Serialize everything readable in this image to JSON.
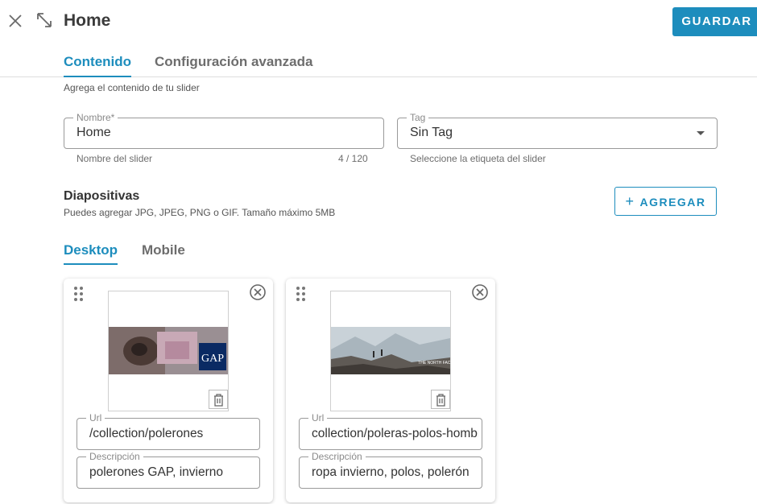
{
  "header": {
    "title": "Home",
    "save_label": "GUARDAR",
    "tabs": [
      {
        "label": "Contenido",
        "active": true
      },
      {
        "label": "Configuración avanzada",
        "active": false
      }
    ]
  },
  "content": {
    "subtitle": "Agrega el contenido de tu slider",
    "name_field": {
      "label": "Nombre*",
      "value": "Home",
      "helper": "Nombre del slider",
      "counter": "4 / 120"
    },
    "tag_field": {
      "label": "Tag",
      "value": "Sin Tag",
      "helper": "Seleccione la etiqueta del slider"
    }
  },
  "slides": {
    "title": "Diapositivas",
    "subtitle": "Puedes agregar JPG, JPEG, PNG o GIF. Tamaño máximo 5MB",
    "add_label": "AGREGAR",
    "tabs": [
      {
        "label": "Desktop",
        "active": true
      },
      {
        "label": "Mobile",
        "active": false
      }
    ],
    "cards": [
      {
        "image": "gap-banner",
        "url_label": "Url",
        "url": "/collection/polerones",
        "desc_label": "Descripción",
        "description": "polerones GAP, invierno"
      },
      {
        "image": "north-face-banner",
        "url_label": "Url",
        "url": "collection/poleras-polos-hombre",
        "desc_label": "Descripción",
        "description": "ropa invierno, polos, polerón"
      }
    ]
  },
  "colors": {
    "accent": "#1d8dbd",
    "border": "#9a9a9a",
    "text": "#333333"
  },
  "icons": {
    "close": "close-icon",
    "expand": "expand-icon",
    "dropdown": "caret-down-icon",
    "add": "plus-icon",
    "drag": "drag-handle-icon",
    "remove": "circle-close-icon",
    "delete": "trash-icon"
  }
}
